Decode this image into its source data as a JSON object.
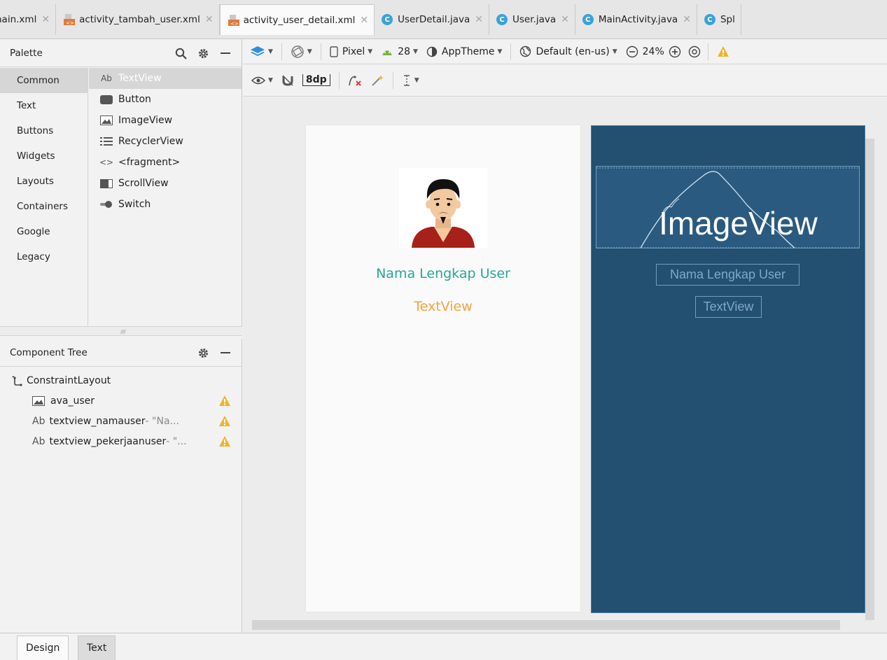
{
  "tabs": [
    {
      "label": "nain.xml",
      "kind": "xml",
      "active": false
    },
    {
      "label": "activity_tambah_user.xml",
      "kind": "layout",
      "active": false
    },
    {
      "label": "activity_user_detail.xml",
      "kind": "layout",
      "active": true
    },
    {
      "label": "UserDetail.java",
      "kind": "java",
      "active": false
    },
    {
      "label": "User.java",
      "kind": "java",
      "active": false
    },
    {
      "label": "MainActivity.java",
      "kind": "java",
      "active": false
    },
    {
      "label": "Spl",
      "kind": "java",
      "active": false
    }
  ],
  "palette": {
    "title": "Palette",
    "categories": [
      "Common",
      "Text",
      "Buttons",
      "Widgets",
      "Layouts",
      "Containers",
      "Google",
      "Legacy"
    ],
    "selected_category": "Common",
    "widgets": [
      {
        "prefix": "Ab",
        "label": "TextView",
        "icon": "textview-icon"
      },
      {
        "prefix": "",
        "label": "Button",
        "icon": "button-icon"
      },
      {
        "prefix": "",
        "label": "ImageView",
        "icon": "image-icon"
      },
      {
        "prefix": "",
        "label": "RecyclerView",
        "icon": "list-icon"
      },
      {
        "prefix": "",
        "label": "<fragment>",
        "icon": "code-brackets-icon"
      },
      {
        "prefix": "",
        "label": "ScrollView",
        "icon": "scrollview-icon"
      },
      {
        "prefix": "",
        "label": "Switch",
        "icon": "switch-icon"
      }
    ]
  },
  "component_tree": {
    "title": "Component Tree",
    "nodes": [
      {
        "prefix": "",
        "label": "ConstraintLayout",
        "hint": "",
        "warning": false,
        "icon": "constraint-layout-icon"
      },
      {
        "prefix": "",
        "label": "ava_user",
        "hint": "",
        "warning": true,
        "icon": "image-icon"
      },
      {
        "prefix": "Ab",
        "label": "textview_namauser",
        "hint": "- \"Na...",
        "warning": true,
        "icon": "textview-icon"
      },
      {
        "prefix": "Ab",
        "label": "textview_pekerjaanuser",
        "hint": "- \"...",
        "warning": true,
        "icon": "textview-icon"
      }
    ]
  },
  "toolbar": {
    "device": "Pixel",
    "api": "28",
    "theme": "AppTheme",
    "locale": "Default (en-us)",
    "zoom": "24%",
    "margin": "8dp"
  },
  "preview": {
    "name_text": "Nama Lengkap User",
    "job_text": "TextView",
    "name_color": "#26a69a",
    "job_color": "#f2a33a"
  },
  "blueprint": {
    "image_label": "ImageView",
    "name_text": "Nama Lengkap User",
    "job_text": "TextView",
    "background": "#234f70"
  },
  "bottom_tabs": {
    "design": "Design",
    "text": "Text"
  }
}
